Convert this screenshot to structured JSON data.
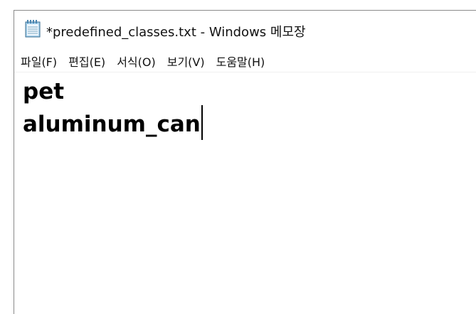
{
  "window": {
    "title": "*predefined_classes.txt - Windows 메모장",
    "icon": "notepad-icon"
  },
  "menu": {
    "items": [
      {
        "label": "파일(F)"
      },
      {
        "label": "편집(E)"
      },
      {
        "label": "서식(O)"
      },
      {
        "label": "보기(V)"
      },
      {
        "label": "도움말(H)"
      }
    ]
  },
  "editor": {
    "lines": [
      "pet",
      "aluminum_can"
    ]
  }
}
